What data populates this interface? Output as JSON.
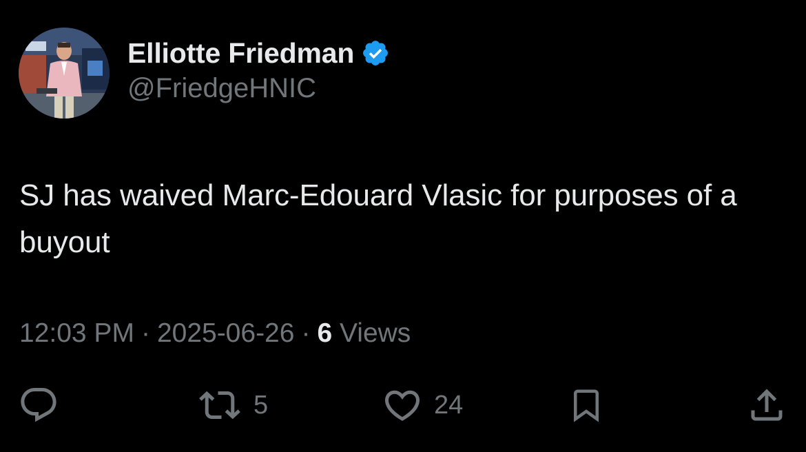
{
  "author": {
    "display_name": "Elliotte Friedman",
    "handle": "@FriedgeHNIC",
    "verified": true,
    "avatar_icon": "avatar-photo"
  },
  "tweet": {
    "text": "SJ has waived Marc-Edouard Vlasic for purposes of a buyout",
    "time": "12:03 PM",
    "separator": "·",
    "date": "2025-06-26",
    "views_count": "6",
    "views_label": "Views"
  },
  "actions": {
    "reply": {
      "icon": "reply-icon",
      "count": ""
    },
    "retweet": {
      "icon": "retweet-icon",
      "count": "5"
    },
    "like": {
      "icon": "heart-icon",
      "count": "24"
    },
    "bookmark": {
      "icon": "bookmark-icon",
      "count": ""
    },
    "share": {
      "icon": "share-icon",
      "count": ""
    }
  },
  "colors": {
    "background": "#000000",
    "primary_text": "#e7e9ea",
    "secondary_text": "#71767b",
    "verified_badge": "#1d9bf0"
  }
}
